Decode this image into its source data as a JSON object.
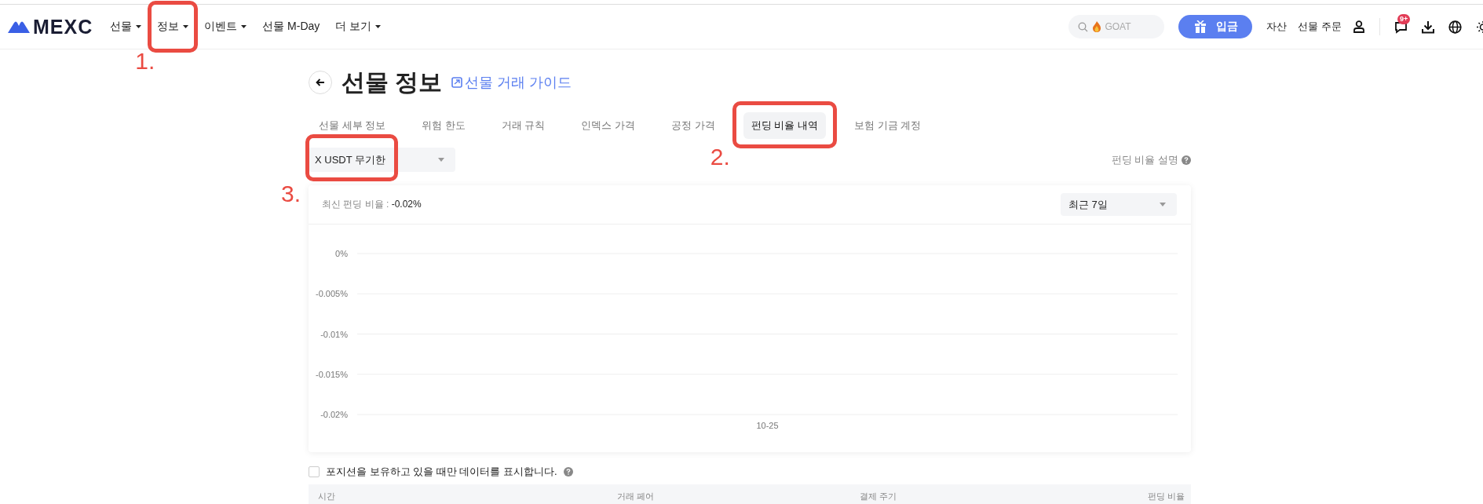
{
  "nav": {
    "logo": "MEXC",
    "items": [
      {
        "label": "선물",
        "dropdown": true
      },
      {
        "label": "정보",
        "dropdown": true,
        "marker": "1."
      },
      {
        "label": "이벤트",
        "dropdown": true
      },
      {
        "label": "선물 M-Day",
        "dropdown": false
      },
      {
        "label": "더 보기",
        "dropdown": true
      }
    ],
    "search": {
      "placeholder": "GOAT"
    },
    "deposit": "입금",
    "links": [
      "자산",
      "선물 주문"
    ],
    "badge": "9+"
  },
  "page": {
    "title": "선물 정보",
    "guide": "선물 거래 가이드"
  },
  "tabs": [
    {
      "label": "선물 세부 정보",
      "selected": false
    },
    {
      "label": "위험 한도",
      "selected": false
    },
    {
      "label": "거래 규칙",
      "selected": false
    },
    {
      "label": "인덱스 가격",
      "selected": false
    },
    {
      "label": "공정 가격",
      "selected": false
    },
    {
      "label": "펀딩 비율 내역",
      "selected": true,
      "marker": "2."
    },
    {
      "label": "보험 기금 계정",
      "selected": false
    }
  ],
  "symbol_select": {
    "value": "X USDT 무기한",
    "marker": "3."
  },
  "explain_link": "펀딩 비율 설명",
  "chart_card": {
    "latest_label": "최신 펀딩 비율 :",
    "latest_value": "-0.02%",
    "period": "최근 7일",
    "chart_data": {
      "type": "line",
      "grid": true,
      "categories": [
        "10-25"
      ],
      "ylim": [
        -0.02,
        0
      ],
      "yticks": [
        {
          "value": 0,
          "label": "0%"
        },
        {
          "value": -0.005,
          "label": "-0.005%"
        },
        {
          "value": -0.01,
          "label": "-0.01%"
        },
        {
          "value": -0.015,
          "label": "-0.015%"
        },
        {
          "value": -0.02,
          "label": "-0.02%"
        }
      ]
    }
  },
  "filter": {
    "label": "포지션을 보유하고 있을 때만 데이터를 표시합니다.",
    "checked": false
  },
  "table": {
    "columns": [
      "시간",
      "거래 페어",
      "결제 주기",
      "펀딩 비율"
    ]
  }
}
